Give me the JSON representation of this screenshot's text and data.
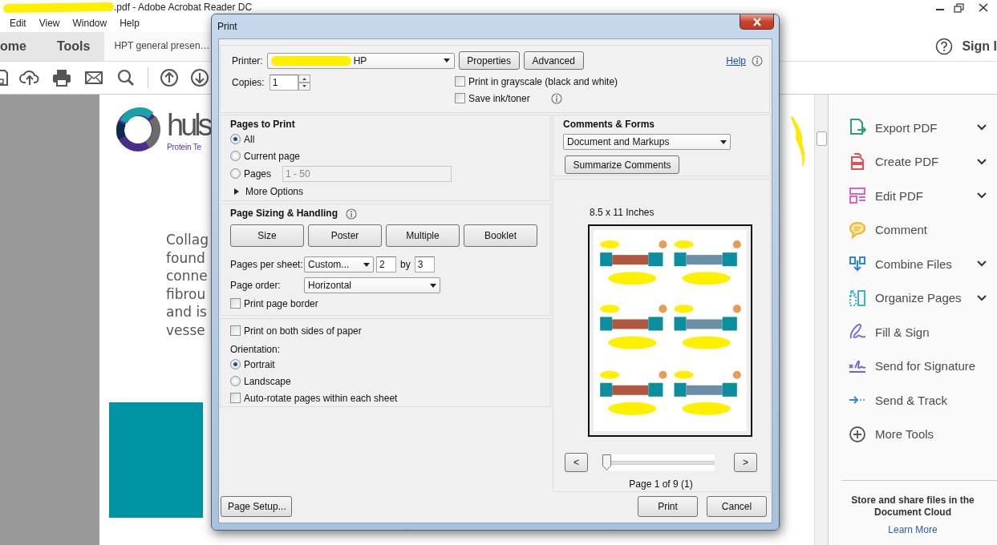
{
  "app": {
    "title": ".pdf - Adobe Acrobat Reader DC",
    "menu": [
      "Edit",
      "View",
      "Window",
      "Help"
    ],
    "tabs": [
      {
        "label": "ome",
        "selected": false
      },
      {
        "label": "Tools",
        "selected": false
      },
      {
        "label": "HPT general presen…",
        "selected": true
      }
    ],
    "sign_in": "Sign I"
  },
  "document": {
    "logo_text": "huls",
    "logo_subtext": "Protein Te",
    "paragraph_lines": [
      "Collag",
      "found",
      "conne",
      "fibrou",
      "and is",
      "vesse"
    ]
  },
  "tools_pane": {
    "tools": [
      {
        "label": "Export PDF",
        "kind": "export",
        "color": "#2e9e77",
        "expandable": true
      },
      {
        "label": "Create PDF",
        "kind": "create",
        "color": "#e0524e",
        "expandable": true
      },
      {
        "label": "Edit PDF",
        "kind": "edit",
        "color": "#d665c7",
        "expandable": true
      },
      {
        "label": "Comment",
        "kind": "comment",
        "color": "#f0b429",
        "expandable": false
      },
      {
        "label": "Combine Files",
        "kind": "combine",
        "color": "#2f86d6",
        "expandable": true
      },
      {
        "label": "Organize Pages",
        "kind": "organize",
        "color": "#3bb3cf",
        "expandable": true
      },
      {
        "label": "Fill & Sign",
        "kind": "sign",
        "color": "#7a6fe0",
        "expandable": false
      },
      {
        "label": "Send for Signature",
        "kind": "signature",
        "color": "#6c63d8",
        "expandable": false
      },
      {
        "label": "Send & Track",
        "kind": "track",
        "color": "#2a8fc9",
        "expandable": false
      },
      {
        "label": "More Tools",
        "kind": "more",
        "color": "#555555",
        "expandable": false
      }
    ],
    "cloud_text": "Store and share files in the Document Cloud",
    "cloud_link": "Learn More"
  },
  "dialog": {
    "title": "Print",
    "help": "Help",
    "printer": {
      "label": "Printer:",
      "value": "HP"
    },
    "top_buttons": [
      "Properties",
      "Advanced"
    ],
    "copies": {
      "label": "Copies:",
      "value": "1"
    },
    "options": [
      {
        "label": "Print in grayscale (black and white)",
        "checked": false,
        "info": false
      },
      {
        "label": "Save ink/toner",
        "checked": false,
        "info": true
      }
    ],
    "pages_to_print": {
      "title": "Pages to Print",
      "choices": [
        {
          "label": "All",
          "selected": true
        },
        {
          "label": "Current page",
          "selected": false
        },
        {
          "label": "Pages",
          "selected": false,
          "range": "1 - 50",
          "disabled": true
        }
      ],
      "more": "More Options"
    },
    "sizing": {
      "title": "Page Sizing & Handling",
      "modes": [
        "Size",
        "Poster",
        "Multiple",
        "Booklet"
      ],
      "pages_per_sheet": {
        "label": "Pages per sheet:",
        "value": "Custom...",
        "columns": "2",
        "by": "by",
        "rows": "3"
      },
      "page_order": {
        "label": "Page order:",
        "value": "Horizontal"
      },
      "border": {
        "label": "Print page border",
        "checked": false
      }
    },
    "duplex": {
      "label": "Print on both sides of paper",
      "checked": false
    },
    "orientation": {
      "title": "Orientation:",
      "choices": [
        {
          "label": "Portrait",
          "selected": true
        },
        {
          "label": "Landscape",
          "selected": false
        }
      ],
      "auto_rotate": {
        "label": "Auto-rotate pages within each sheet",
        "checked": false
      }
    },
    "comments": {
      "title": "Comments & Forms",
      "value": "Document and Markups",
      "button": "Summarize Comments"
    },
    "preview": {
      "size": "8.5 x 11 Inches",
      "prev": "<",
      "next": ">",
      "slider": {
        "level": 0
      },
      "page": "Page 1 of 9 (1)"
    },
    "bottom": {
      "setup": "Page Setup...",
      "print": "Print",
      "cancel": "Cancel"
    }
  }
}
